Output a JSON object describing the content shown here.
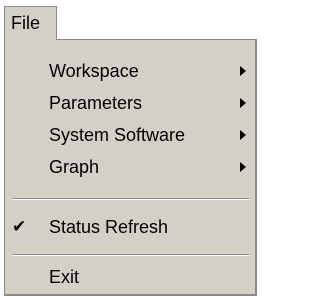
{
  "menubar": {
    "file_label": "File"
  },
  "menu": {
    "items": [
      {
        "label": "Workspace",
        "submenu_icon": "triangle-right-icon"
      },
      {
        "label": "Parameters",
        "submenu_icon": "triangle-right-icon"
      },
      {
        "label": "System Software",
        "submenu_icon": "triangle-right-icon"
      },
      {
        "label": "Graph",
        "submenu_icon": "triangle-right-icon"
      },
      {
        "label": "Status Refresh",
        "checked": true,
        "check_glyph": "✔"
      },
      {
        "label": "Exit"
      }
    ]
  },
  "colors": {
    "menu_background": "#d4d0c8",
    "border": "#8a8a8a",
    "text": "#000000"
  }
}
